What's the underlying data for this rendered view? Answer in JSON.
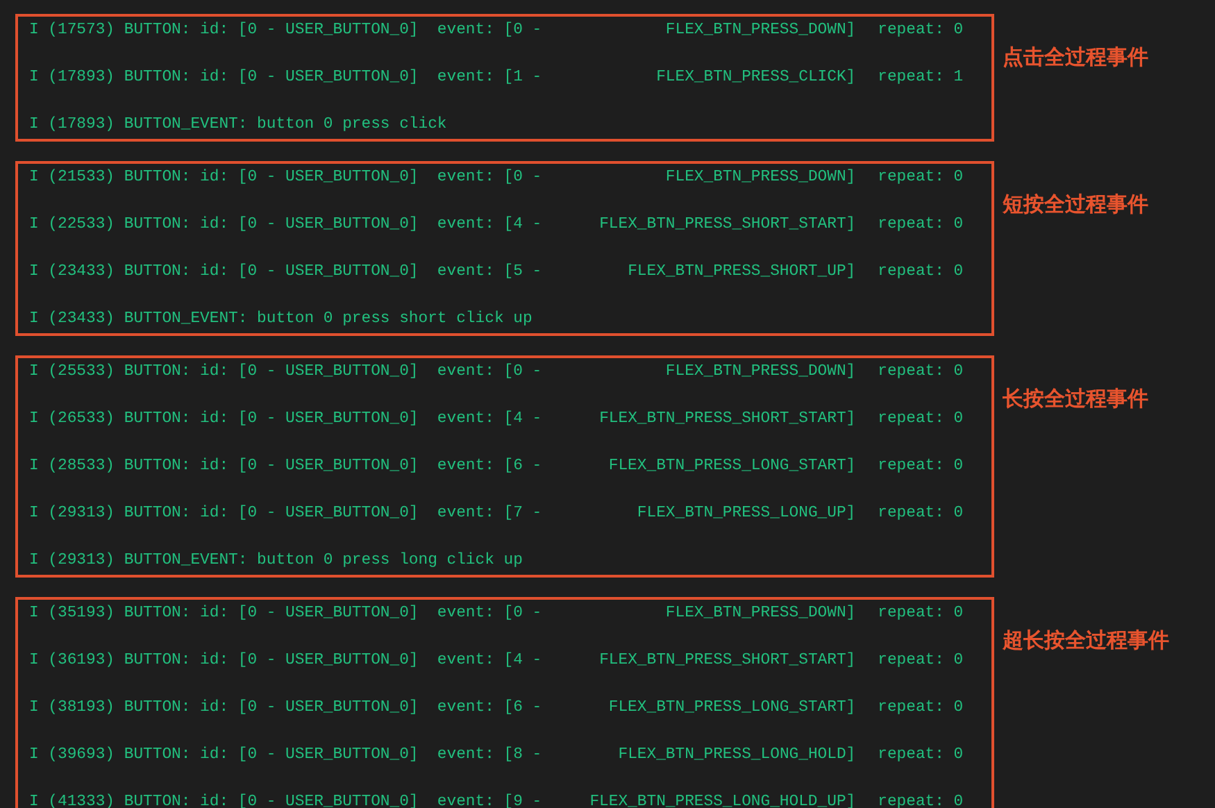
{
  "groups": [
    {
      "label": "点击全过程事件",
      "lines": [
        {
          "kind": "event",
          "head": "I (17573) BUTTON: id: [0 - USER_BUTTON_0]  event: [0 -",
          "event": "FLEX_BTN_PRESS_DOWN]",
          "repeat": "repeat: 0"
        },
        {
          "kind": "event",
          "head": "I (17893) BUTTON: id: [0 - USER_BUTTON_0]  event: [1 -",
          "event": "FLEX_BTN_PRESS_CLICK]",
          "repeat": "repeat: 1"
        },
        {
          "kind": "message",
          "text": "I (17893) BUTTON_EVENT: button 0 press click"
        }
      ]
    },
    {
      "label": "短按全过程事件",
      "lines": [
        {
          "kind": "event",
          "head": "I (21533) BUTTON: id: [0 - USER_BUTTON_0]  event: [0 -",
          "event": "FLEX_BTN_PRESS_DOWN]",
          "repeat": "repeat: 0"
        },
        {
          "kind": "event",
          "head": "I (22533) BUTTON: id: [0 - USER_BUTTON_0]  event: [4 -",
          "event": "FLEX_BTN_PRESS_SHORT_START]",
          "repeat": "repeat: 0"
        },
        {
          "kind": "event",
          "head": "I (23433) BUTTON: id: [0 - USER_BUTTON_0]  event: [5 -",
          "event": "FLEX_BTN_PRESS_SHORT_UP]",
          "repeat": "repeat: 0"
        },
        {
          "kind": "message",
          "text": "I (23433) BUTTON_EVENT: button 0 press short click up"
        }
      ]
    },
    {
      "label": "长按全过程事件",
      "lines": [
        {
          "kind": "event",
          "head": "I (25533) BUTTON: id: [0 - USER_BUTTON_0]  event: [0 -",
          "event": "FLEX_BTN_PRESS_DOWN]",
          "repeat": "repeat: 0"
        },
        {
          "kind": "event",
          "head": "I (26533) BUTTON: id: [0 - USER_BUTTON_0]  event: [4 -",
          "event": "FLEX_BTN_PRESS_SHORT_START]",
          "repeat": "repeat: 0"
        },
        {
          "kind": "event",
          "head": "I (28533) BUTTON: id: [0 - USER_BUTTON_0]  event: [6 -",
          "event": "FLEX_BTN_PRESS_LONG_START]",
          "repeat": "repeat: 0"
        },
        {
          "kind": "event",
          "head": "I (29313) BUTTON: id: [0 - USER_BUTTON_0]  event: [7 -",
          "event": "FLEX_BTN_PRESS_LONG_UP]",
          "repeat": "repeat: 0"
        },
        {
          "kind": "message",
          "text": "I (29313) BUTTON_EVENT: button 0 press long click up"
        }
      ]
    },
    {
      "label": "超长按全过程事件",
      "lines": [
        {
          "kind": "event",
          "head": "I (35193) BUTTON: id: [0 - USER_BUTTON_0]  event: [0 -",
          "event": "FLEX_BTN_PRESS_DOWN]",
          "repeat": "repeat: 0"
        },
        {
          "kind": "event",
          "head": "I (36193) BUTTON: id: [0 - USER_BUTTON_0]  event: [4 -",
          "event": "FLEX_BTN_PRESS_SHORT_START]",
          "repeat": "repeat: 0"
        },
        {
          "kind": "event",
          "head": "I (38193) BUTTON: id: [0 - USER_BUTTON_0]  event: [6 -",
          "event": "FLEX_BTN_PRESS_LONG_START]",
          "repeat": "repeat: 0"
        },
        {
          "kind": "event",
          "head": "I (39693) BUTTON: id: [0 - USER_BUTTON_0]  event: [8 -",
          "event": "FLEX_BTN_PRESS_LONG_HOLD]",
          "repeat": "repeat: 0"
        },
        {
          "kind": "event",
          "head": "I (41333) BUTTON: id: [0 - USER_BUTTON_0]  event: [9 -",
          "event": "FLEX_BTN_PRESS_LONG_HOLD_UP]",
          "repeat": "repeat: 0"
        }
      ]
    }
  ]
}
